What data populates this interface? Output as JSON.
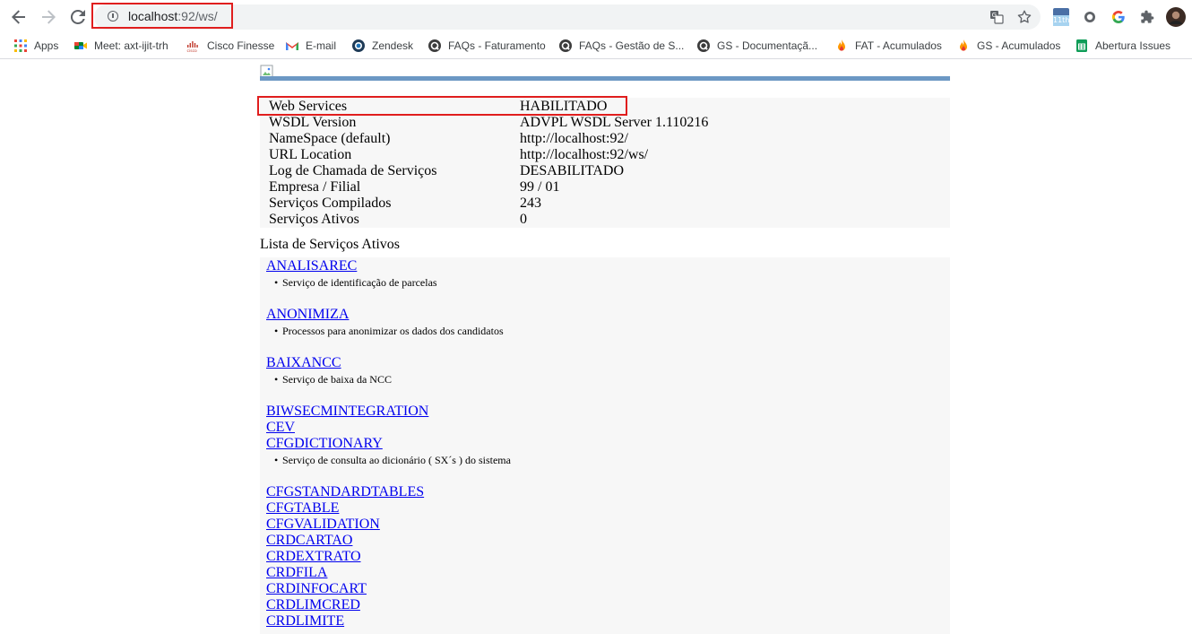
{
  "browser": {
    "url_host": "localhost",
    "url_path": ":92/ws/",
    "colors": {
      "highlight": "#e01e1e",
      "link": "#0000ee",
      "rule": "#6c98c4"
    },
    "toolbar_icons": [
      "back-icon",
      "forward-icon",
      "reload-icon",
      "info-icon",
      "translate-icon",
      "star-icon",
      "calendar-extension-icon",
      "extension-circle-icon",
      "google-icon",
      "puzzle-icon",
      "profile-avatar"
    ],
    "calendar_badge": "11th"
  },
  "bookmarks": [
    {
      "label": "Apps"
    },
    {
      "label": "Meet: axt-ijit-trh"
    },
    {
      "label": "Cisco Finesse"
    },
    {
      "label": "E-mail"
    },
    {
      "label": "Zendesk"
    },
    {
      "label": "FAQs - Faturamento"
    },
    {
      "label": "FAQs - Gestão de S..."
    },
    {
      "label": "GS - Documentaçã..."
    },
    {
      "label": "FAT - Acumulados"
    },
    {
      "label": "GS - Acumulados"
    },
    {
      "label": "Abertura Issues"
    }
  ],
  "info": [
    {
      "label": "Web Services",
      "value": "HABILITADO"
    },
    {
      "label": "WSDL Version",
      "value": "ADVPL WSDL Server 1.110216"
    },
    {
      "label": "NameSpace (default)",
      "value": "http://localhost:92/"
    },
    {
      "label": "URL Location",
      "value": "http://localhost:92/ws/"
    },
    {
      "label": "Log de Chamada de Serviços",
      "value": "DESABILITADO"
    },
    {
      "label": "Empresa / Filial",
      "value": "99 / 01"
    },
    {
      "label": "Serviços Compilados",
      "value": "243"
    },
    {
      "label": "Serviços Ativos",
      "value": "0"
    }
  ],
  "list_title": "Lista de Serviços Ativos",
  "services": [
    {
      "name": "ANALISAREC",
      "desc": "Serviço de identificação de parcelas"
    },
    {
      "name": "ANONIMIZA",
      "desc": "Processos para anonimizar os dados dos candidatos"
    },
    {
      "name": "BAIXANCC",
      "desc": "Serviço de baixa da NCC"
    },
    {
      "name": "BIWSECMINTEGRATION"
    },
    {
      "name": "CEV"
    },
    {
      "name": "CFGDICTIONARY",
      "desc": "Serviço de consulta ao dicionário ( SX´s ) do sistema"
    },
    {
      "name": "CFGSTANDARDTABLES"
    },
    {
      "name": "CFGTABLE"
    },
    {
      "name": "CFGVALIDATION"
    },
    {
      "name": "CRDCARTAO"
    },
    {
      "name": "CRDEXTRATO"
    },
    {
      "name": "CRDFILA"
    },
    {
      "name": "CRDINFOCART"
    },
    {
      "name": "CRDLIMCRED"
    },
    {
      "name": "CRDLIMITE"
    }
  ]
}
